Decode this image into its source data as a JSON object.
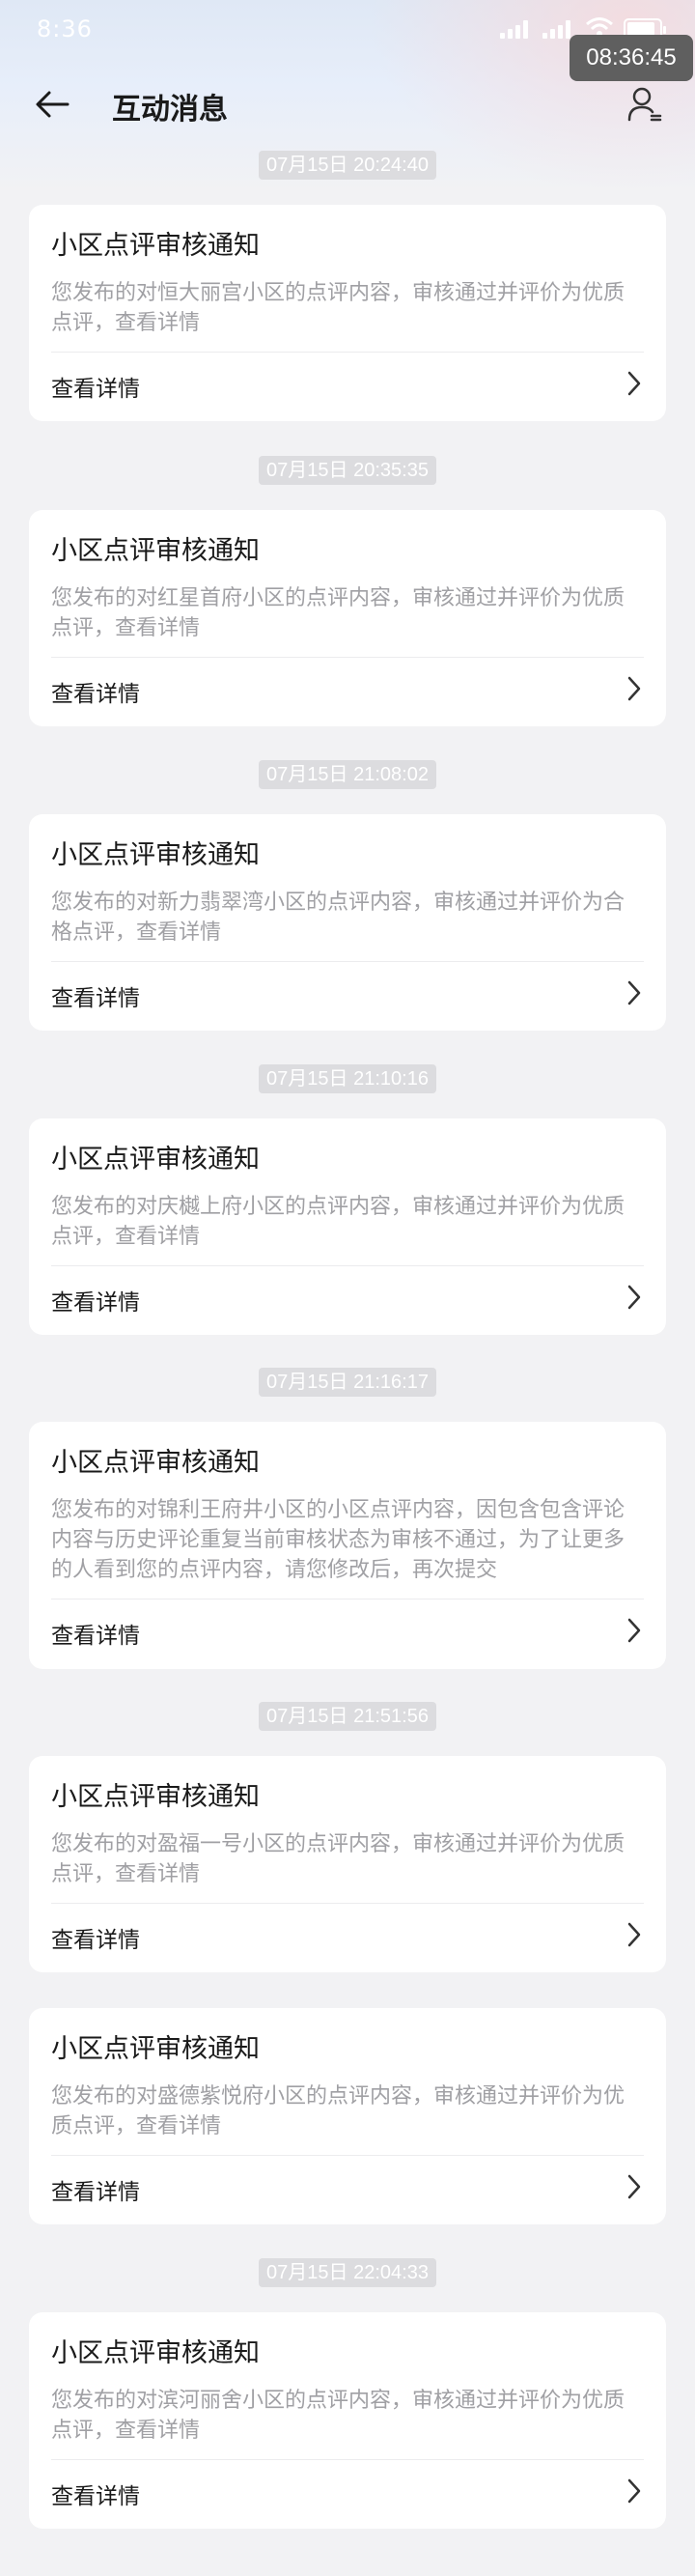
{
  "status_bar": {
    "time": "8:36"
  },
  "clock_overlay": "08:36:45",
  "header": {
    "title": "互动消息"
  },
  "messages": [
    {
      "time": "07月15日 20:24:40",
      "title": "小区点评审核通知",
      "body": "您发布的对恒大丽宫小区的点评内容，审核通过并评价为优质点评，查看详情",
      "action": "查看详情"
    },
    {
      "time": "07月15日 20:35:35",
      "title": "小区点评审核通知",
      "body": "您发布的对红星首府小区的点评内容，审核通过并评价为优质点评，查看详情",
      "action": "查看详情"
    },
    {
      "time": "07月15日 21:08:02",
      "title": "小区点评审核通知",
      "body": "您发布的对新力翡翠湾小区的点评内容，审核通过并评价为合格点评，查看详情",
      "action": "查看详情"
    },
    {
      "time": "07月15日 21:10:16",
      "title": "小区点评审核通知",
      "body": "您发布的对庆樾上府小区的点评内容，审核通过并评价为优质点评，查看详情",
      "action": "查看详情"
    },
    {
      "time": "07月15日 21:16:17",
      "title": "小区点评审核通知",
      "body": "您发布的对锦利王府井小区的小区点评内容，因包含包含评论内容与历史评论重复当前审核状态为审核不通过，为了让更多的人看到您的点评内容，请您修改后，再次提交",
      "action": "查看详情"
    },
    {
      "time": "07月15日 21:51:56",
      "title": "小区点评审核通知",
      "body": "您发布的对盈福一号小区的点评内容，审核通过并评价为优质点评，查看详情",
      "action": "查看详情"
    },
    {
      "time": "",
      "title": "小区点评审核通知",
      "body": "您发布的对盛德紫悦府小区的点评内容，审核通过并评价为优质点评，查看详情",
      "action": "查看详情"
    },
    {
      "time": "07月15日 22:04:33",
      "title": "小区点评审核通知",
      "body": "您发布的对滨河丽舍小区的点评内容，审核通过并评价为优质点评，查看详情",
      "action": "查看详情"
    }
  ]
}
